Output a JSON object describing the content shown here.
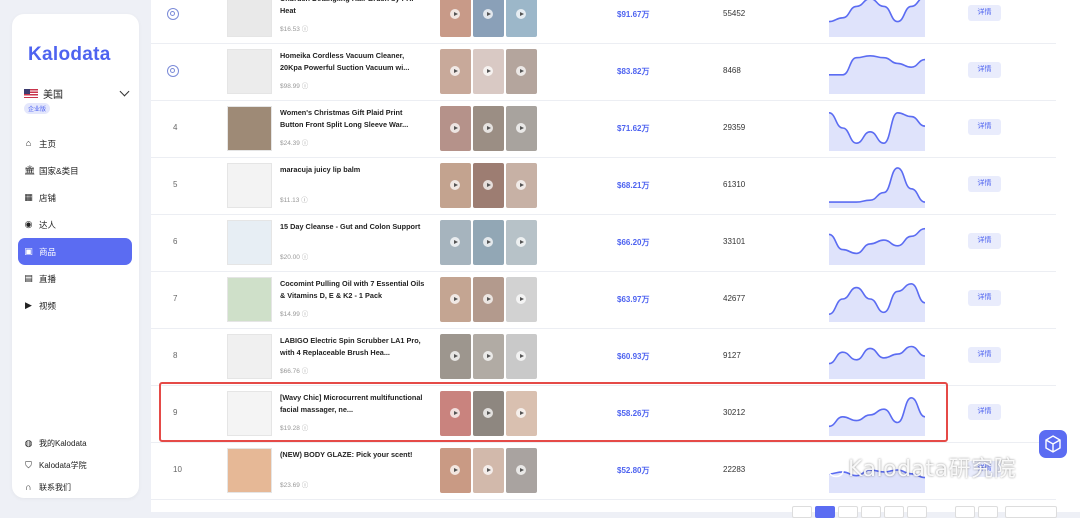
{
  "app": {
    "logo": "Kalodata",
    "region": "美国",
    "plan_badge": "企业版"
  },
  "nav": [
    {
      "label": "主页",
      "icon": "home-icon"
    },
    {
      "label": "国家&类目",
      "icon": "bank-icon"
    },
    {
      "label": "店铺",
      "icon": "shop-icon"
    },
    {
      "label": "达人",
      "icon": "person-icon"
    },
    {
      "label": "商品",
      "icon": "bag-icon",
      "active": true
    },
    {
      "label": "直播",
      "icon": "live-icon"
    },
    {
      "label": "视频",
      "icon": "video-icon"
    }
  ],
  "bottom_nav": [
    {
      "label": "我的Kalodata",
      "icon": "user-icon"
    },
    {
      "label": "Kalodata学院",
      "icon": "graduation-cap-icon"
    },
    {
      "label": "联系我们",
      "icon": "headset-icon"
    }
  ],
  "products": [
    {
      "rank": "",
      "name": "Unbrush Detangling Hair Brush by FHI Heat",
      "price": "$16.53",
      "sales": "$91.67万",
      "count": "55452",
      "trend": [
        0.7,
        0.6,
        0.3,
        0.1,
        0.3,
        0.7,
        0.3,
        0.05
      ],
      "thumb": "#e9e9e9",
      "vids": [
        "#c89a88",
        "#8aa0b8",
        "#9cb7c9"
      ]
    },
    {
      "rank": "",
      "name": "Homeika Cordless Vacuum Cleaner, 20Kpa Powerful Suction Vacuum wi...",
      "price": "$98.99",
      "sales": "$83.82万",
      "count": "8468",
      "trend": [
        0.6,
        0.6,
        0.15,
        0.1,
        0.15,
        0.3,
        0.4,
        0.2
      ],
      "thumb": "#ececec",
      "vids": [
        "#c8a99a",
        "#d9c9c4",
        "#b4a59d"
      ]
    },
    {
      "rank": "4",
      "name": "Women's Christmas Gift Plaid Print Button Front Split Long Sleeve War...",
      "price": "$24.39",
      "sales": "$71.62万",
      "count": "29359",
      "trend": [
        0.1,
        0.5,
        0.9,
        0.6,
        0.9,
        0.1,
        0.2,
        0.45
      ],
      "thumb": "#9e8a76",
      "vids": [
        "#b5928a",
        "#9b8e84",
        "#a8a39e"
      ]
    },
    {
      "rank": "5",
      "name": "maracuja juicy lip balm",
      "price": "$11.13",
      "sales": "$68.21万",
      "count": "61310",
      "trend": [
        0.95,
        0.95,
        0.95,
        0.9,
        0.7,
        0.05,
        0.6,
        0.95
      ],
      "thumb": "#f3f3f3",
      "vids": [
        "#c3a38f",
        "#9d7d72",
        "#c7b1a5"
      ]
    },
    {
      "rank": "6",
      "name": "15 Day Cleanse - Gut and Colon Support",
      "price": "$20.00",
      "sales": "$66.20万",
      "count": "33101",
      "trend": [
        0.3,
        0.7,
        0.8,
        0.55,
        0.45,
        0.6,
        0.35,
        0.15
      ],
      "thumb": "#e7eef4",
      "vids": [
        "#a6b4be",
        "#92a7b5",
        "#b7c2c8"
      ]
    },
    {
      "rank": "7",
      "name": "Cocomint Pulling Oil with 7 Essential Oils & Vitamins D, E & K2 - 1 Pack",
      "price": "$14.99",
      "sales": "$63.97万",
      "count": "42677",
      "trend": [
        0.9,
        0.5,
        0.2,
        0.5,
        0.85,
        0.3,
        0.1,
        0.6
      ],
      "thumb": "#cfe0c9",
      "vids": [
        "#c4a592",
        "#b39a8d",
        "#d2d2d2"
      ]
    },
    {
      "rank": "8",
      "name": "LABIGO Electric Spin Scrubber LA1 Pro, with 4 Replaceable Brush Hea...",
      "price": "$66.76",
      "sales": "$60.93万",
      "count": "9127",
      "trend": [
        0.7,
        0.4,
        0.6,
        0.3,
        0.55,
        0.45,
        0.25,
        0.5
      ],
      "thumb": "#f0f0f0",
      "vids": [
        "#9d968e",
        "#b1aba4",
        "#c9c9c9"
      ]
    },
    {
      "rank": "9",
      "name": "[Wavy Chic] Microcurrent multifunctional facial massager, ne...",
      "price": "$19.28",
      "sales": "$58.26万",
      "count": "30212",
      "trend": [
        0.85,
        0.6,
        0.7,
        0.55,
        0.4,
        0.75,
        0.1,
        0.6
      ],
      "thumb": "#f4f4f4",
      "vids": [
        "#c9837e",
        "#8e8780",
        "#d9c0b0"
      ]
    },
    {
      "rank": "10",
      "name": "(NEW) BODY GLAZE: Pick your scent!",
      "price": "$23.69",
      "sales": "$52.80万",
      "count": "22283",
      "trend": [
        0.6,
        0.55,
        0.65,
        0.5,
        0.55,
        0.5,
        0.6,
        0.7
      ],
      "thumb": "#e6b896",
      "vids": [
        "#c99a84",
        "#d2b9ab",
        "#a9a3a0"
      ]
    }
  ],
  "detail_label": "详情",
  "watermark": "Kalodata研究院",
  "colors": {
    "accent": "#5b6cf2",
    "highlight": "#e54a47"
  }
}
